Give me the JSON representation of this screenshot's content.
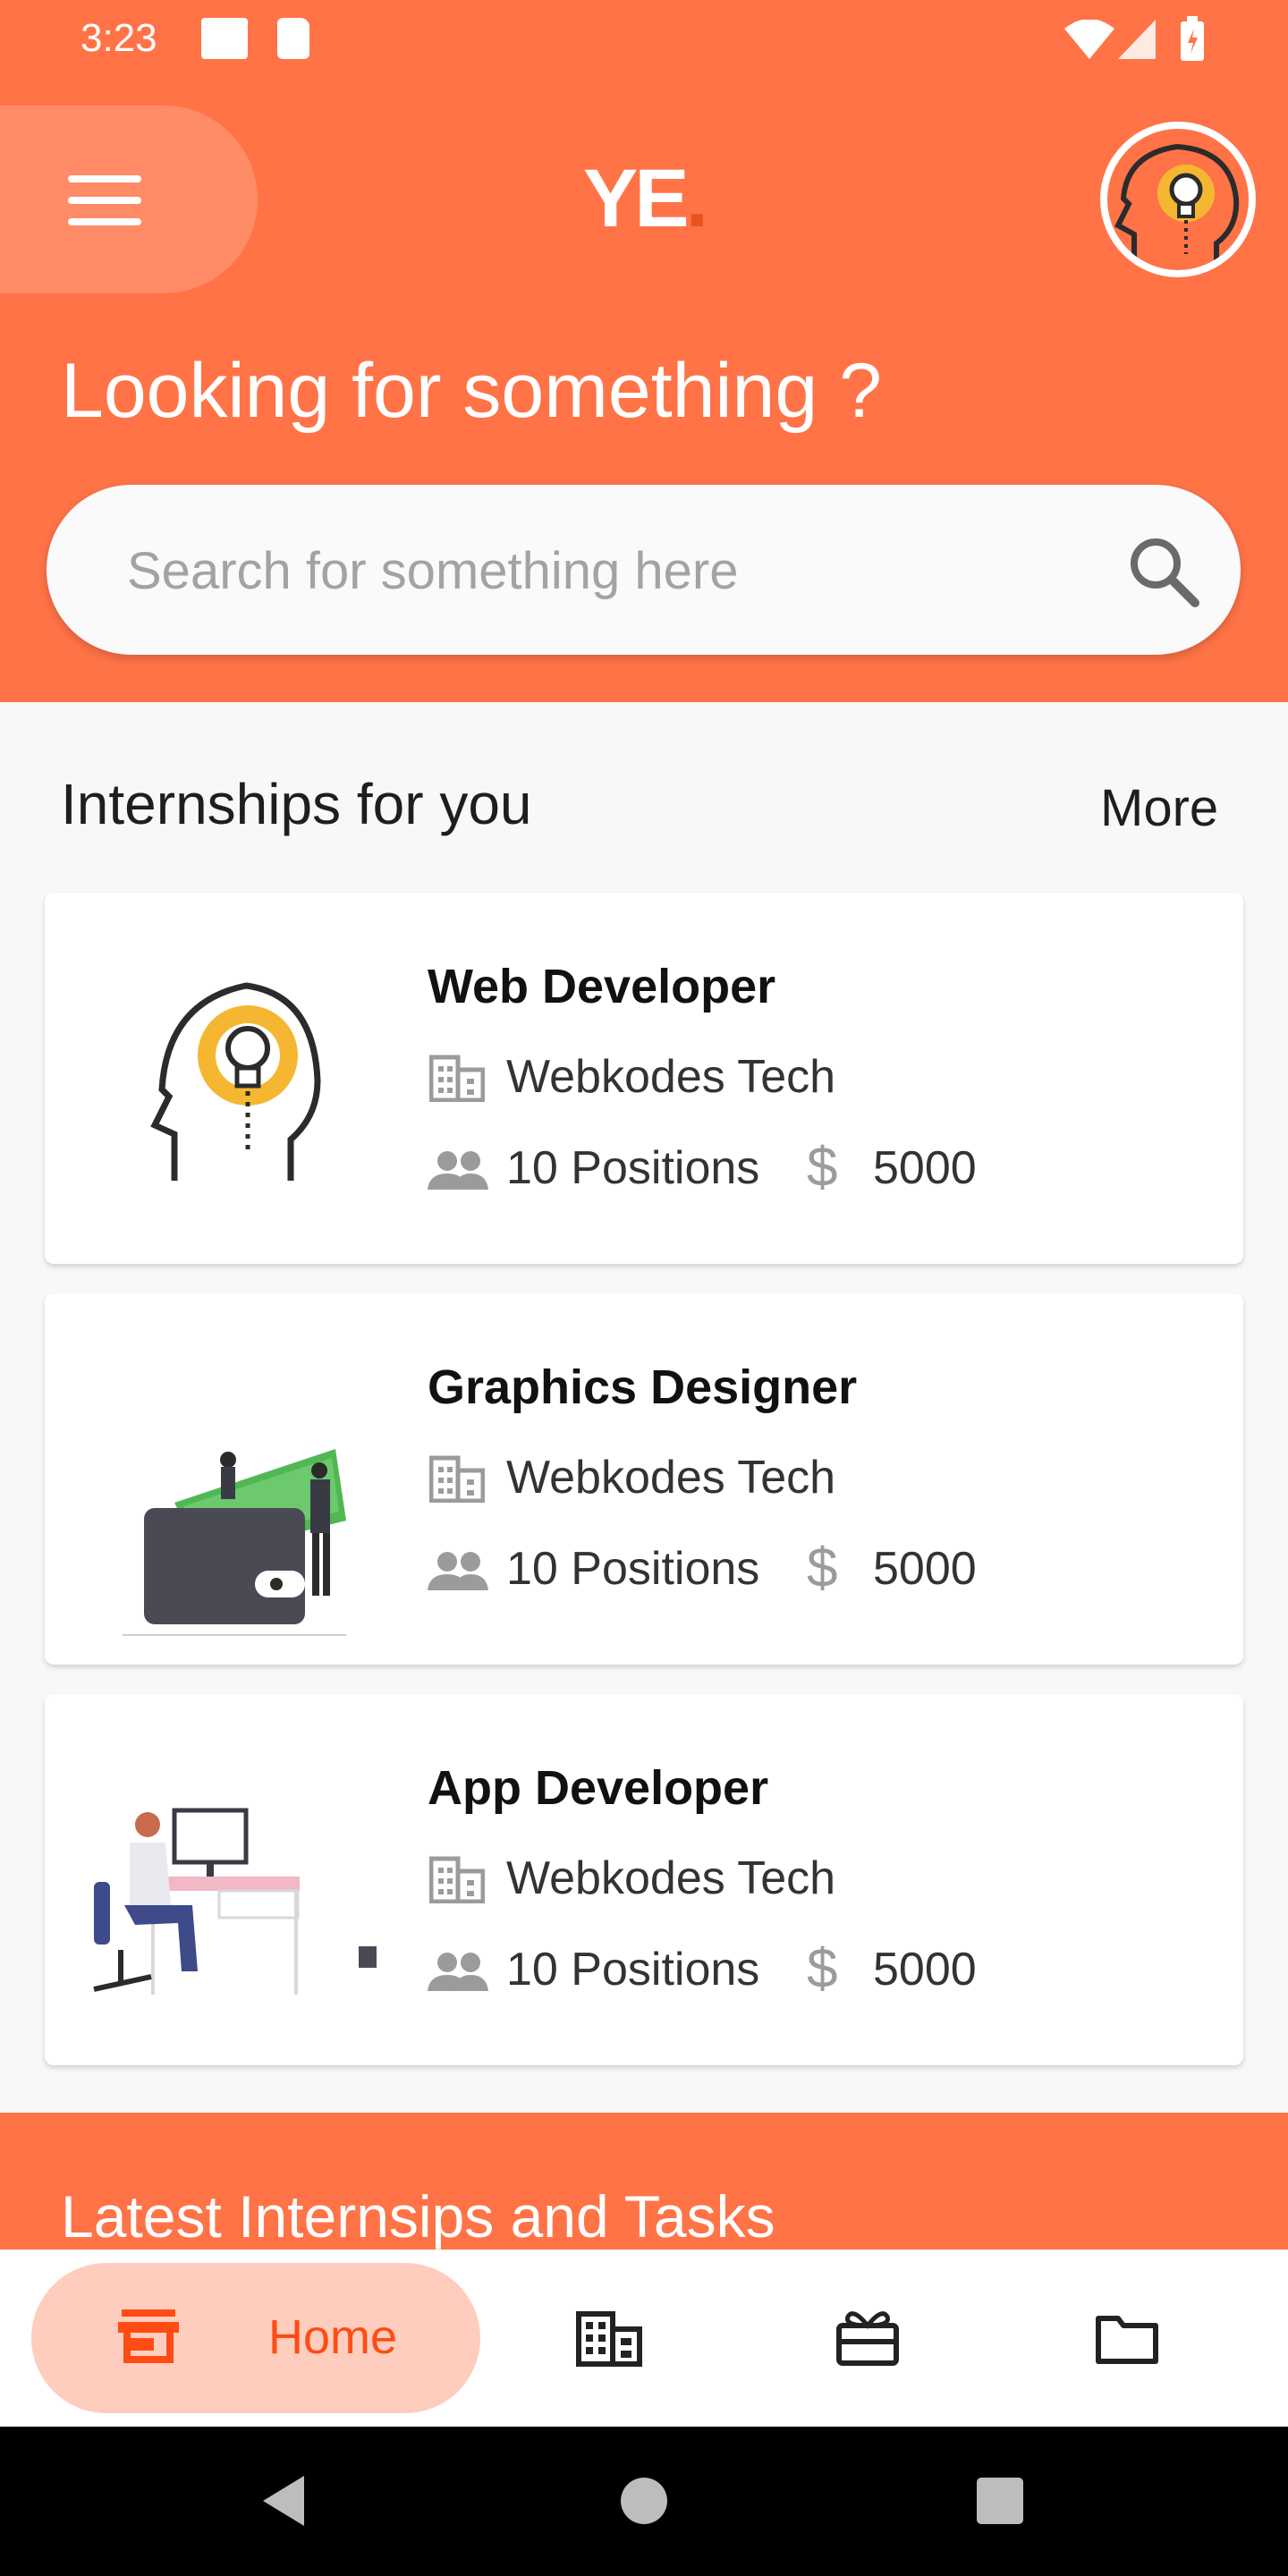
{
  "status_bar": {
    "time": "3:23"
  },
  "header": {
    "logo": "YE",
    "logo_dot": ".",
    "headline": "Looking for something ?"
  },
  "search": {
    "placeholder": "Search for something here"
  },
  "internships": {
    "title": "Internships for you",
    "more_label": "More",
    "cards": [
      {
        "title": "Web Developer",
        "company": "Webkodes Tech",
        "positions": "10 Positions",
        "salary": "5000",
        "illustration": "head-lightbulb-illustration"
      },
      {
        "title": "Graphics Designer",
        "company": "Webkodes Tech",
        "positions": "10 Positions",
        "salary": "5000",
        "illustration": "wallet-money-illustration"
      },
      {
        "title": "App Developer",
        "company": "Webkodes Tech",
        "positions": "10 Positions",
        "salary": "5000",
        "illustration": "person-desk-illustration"
      }
    ]
  },
  "latest": {
    "title": "Latest Internsips and Tasks"
  },
  "bottom_nav": {
    "items": [
      {
        "label": "Home",
        "icon": "store-icon",
        "active": true
      },
      {
        "label": "",
        "icon": "building-icon",
        "active": false
      },
      {
        "label": "",
        "icon": "gift-icon",
        "active": false
      },
      {
        "label": "",
        "icon": "folder-icon",
        "active": false
      }
    ]
  },
  "colors": {
    "accent": "#ff7347",
    "active_pill": "#ffcdbd",
    "active_text": "#ff4c14",
    "bulb": "#f5b731"
  }
}
